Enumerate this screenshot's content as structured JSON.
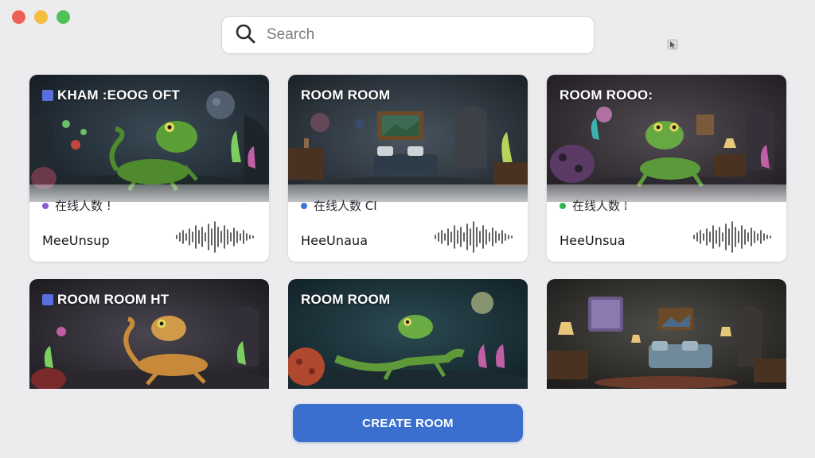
{
  "window": {
    "controls": [
      "close",
      "minimize",
      "maximize"
    ],
    "colors": {
      "close": "#ee5f57",
      "minimize": "#f4bd3f",
      "maximize": "#4fc257"
    }
  },
  "search": {
    "placeholder": "Search",
    "value": "",
    "icon": "search-icon"
  },
  "accent_color": "#3a6fd0",
  "rooms": [
    {
      "title": "KHAM :EOOG OFT",
      "badge": true,
      "online_label": "在线人数 !",
      "online_dot_color": "#8a5ed6",
      "host": "MeeUnsup",
      "scene": "lizard-cave"
    },
    {
      "title": "ROOM ROOM",
      "badge": false,
      "online_label": "在线人数 CI",
      "online_dot_color": "#3d76d8",
      "host": "HeeUnaua",
      "scene": "bedroom"
    },
    {
      "title": "ROOM ROOO:",
      "badge": false,
      "online_label": "在线人数 ⁞",
      "online_dot_color": "#2fb44f",
      "host": "HeeUnsua",
      "scene": "lizard-room"
    },
    {
      "title": "ROOM ROOM HT",
      "badge": true,
      "scene": "orange-lizard"
    },
    {
      "title": "ROOM ROOM",
      "badge": false,
      "scene": "lizard-moon"
    },
    {
      "title": "",
      "badge": false,
      "scene": "living-room"
    }
  ],
  "create_button": {
    "label": "CREATE ROOM"
  }
}
